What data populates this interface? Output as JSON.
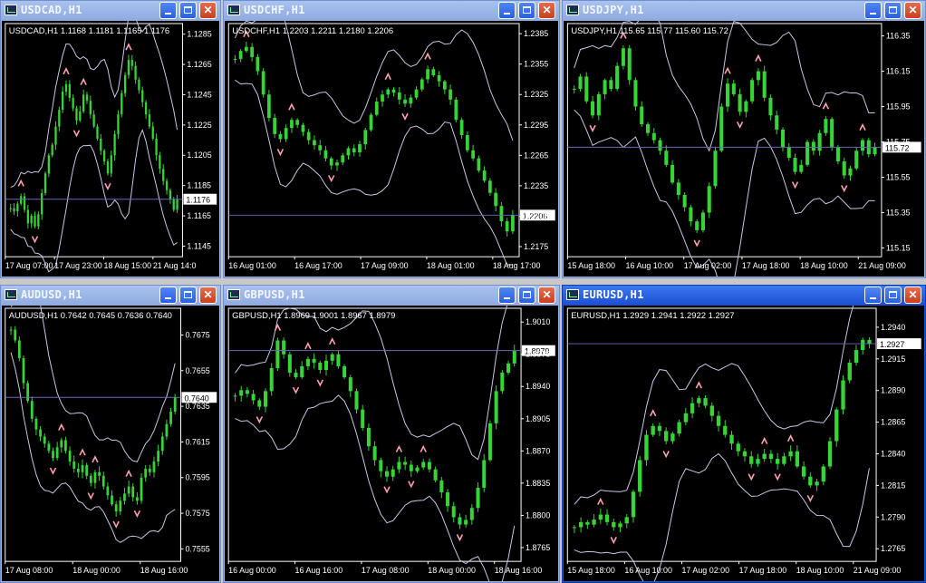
{
  "colors": {
    "bull": "#37d437",
    "band": "#c8c8e6",
    "price_line": "#6a6ab8",
    "arrow": "#ffa0b4",
    "grid": "#ffffff",
    "text": "#ffffff"
  },
  "windows": [
    {
      "id": "usdcad",
      "title": "USDCAD,H1",
      "info": "USDCAD,H1  1.1168 1.1181 1.1165 1.1176",
      "active": false,
      "price_ticks": [
        "1.1285",
        "1.1265",
        "1.1245",
        "1.1225",
        "1.1205",
        "1.1185",
        "1.1165",
        "1.1145"
      ],
      "current_price": "1.1176",
      "time_ticks": [
        "17 Aug 07:00",
        "17 Aug 23:00",
        "18 Aug 15:00",
        "21 Aug 14:0"
      ],
      "chart_data": {
        "type": "candlestick",
        "x_labels": [
          "17 Aug 07:00",
          "17 Aug 23:00",
          "18 Aug 15:00",
          "21 Aug 14:0"
        ],
        "ylim": [
          1.1138,
          1.1292
        ],
        "last": 1.1176,
        "close": [
          1.117,
          1.1168,
          1.1173,
          1.1178,
          1.1169,
          1.116,
          1.1165,
          1.1158,
          1.1166,
          1.118,
          1.1193,
          1.1205,
          1.1212,
          1.1224,
          1.1235,
          1.1247,
          1.1252,
          1.1243,
          1.1236,
          1.1228,
          1.1234,
          1.1245,
          1.1241,
          1.1232,
          1.1224,
          1.1216,
          1.1208,
          1.1201,
          1.1193,
          1.1205,
          1.1219,
          1.1232,
          1.1246,
          1.1258,
          1.1268,
          1.1264,
          1.1255,
          1.1248,
          1.124,
          1.1232,
          1.1224,
          1.1216,
          1.1205,
          1.1196,
          1.1188,
          1.1182,
          1.1176,
          1.1169,
          1.1176
        ]
      }
    },
    {
      "id": "usdchf",
      "title": "USDCHF,H1",
      "info": "USDCHF,H1  1.2203 1.2211 1.2180 1.2206",
      "active": false,
      "price_ticks": [
        "1.2385",
        "1.2355",
        "1.2325",
        "1.2295",
        "1.2265",
        "1.2235",
        "1.2205",
        "1.2175"
      ],
      "current_price": "1.2206",
      "time_ticks": [
        "16 Aug 01:00",
        "16 Aug 17:00",
        "17 Aug 09:00",
        "18 Aug 01:00",
        "18 Aug 17:00"
      ],
      "chart_data": {
        "type": "candlestick",
        "x_labels": [
          "16 Aug 01:00",
          "16 Aug 17:00",
          "17 Aug 09:00",
          "18 Aug 01:00",
          "18 Aug 17:00"
        ],
        "ylim": [
          1.2165,
          1.2395
        ],
        "last": 1.2206,
        "close": [
          1.236,
          1.2368,
          1.2372,
          1.2362,
          1.2348,
          1.2325,
          1.2302,
          1.2286,
          1.2281,
          1.2292,
          1.23,
          1.2295,
          1.2288,
          1.228,
          1.2275,
          1.227,
          1.2262,
          1.2255,
          1.2258,
          1.2265,
          1.2272,
          1.2268,
          1.2276,
          1.229,
          1.2305,
          1.2318,
          1.2325,
          1.233,
          1.2327,
          1.232,
          1.2316,
          1.2322,
          1.233,
          1.234,
          1.235,
          1.2344,
          1.2338,
          1.233,
          1.232,
          1.23,
          1.2285,
          1.227,
          1.2262,
          1.225,
          1.224,
          1.2228,
          1.2215,
          1.22,
          1.219,
          1.2206
        ]
      }
    },
    {
      "id": "usdjpy",
      "title": "USDJPY,H1",
      "info": "USDJPY,H1  115.65 115.77 115.60 115.72",
      "active": false,
      "price_ticks": [
        "116.35",
        "116.15",
        "115.95",
        "115.75",
        "115.55",
        "115.35",
        "115.15"
      ],
      "current_price": "115.72",
      "time_ticks": [
        "15 Aug 18:00",
        "16 Aug 10:00",
        "17 Aug 02:00",
        "17 Aug 18:00",
        "18 Aug 10:00",
        "21 Aug 09:00"
      ],
      "chart_data": {
        "type": "candlestick",
        "x_labels": [
          "15 Aug 18:00",
          "16 Aug 10:00",
          "17 Aug 02:00",
          "17 Aug 18:00",
          "18 Aug 10:00",
          "21 Aug 09:00"
        ],
        "ylim": [
          115.1,
          116.42
        ],
        "last": 115.72,
        "close": [
          116.05,
          116.12,
          115.98,
          115.9,
          116.02,
          116.1,
          116.05,
          116.18,
          116.28,
          116.1,
          115.95,
          115.85,
          115.8,
          115.76,
          115.7,
          115.62,
          115.52,
          115.45,
          115.38,
          115.3,
          115.25,
          115.35,
          115.5,
          115.7,
          115.95,
          116.08,
          116.02,
          115.92,
          115.98,
          116.1,
          116.15,
          116.0,
          115.9,
          115.82,
          115.72,
          115.66,
          115.58,
          115.62,
          115.75,
          115.7,
          115.8,
          115.88,
          115.72,
          115.64,
          115.56,
          115.6,
          115.7,
          115.76,
          115.68,
          115.72
        ]
      }
    },
    {
      "id": "audusd",
      "title": "AUDUSD,H1",
      "info": "AUDUSD,H1  0.7642 0.7645 0.7636 0.7640",
      "active": false,
      "price_ticks": [
        "0.7675",
        "0.7655",
        "0.7635",
        "0.7615",
        "0.7595",
        "0.7575",
        "0.7555"
      ],
      "current_price": "0.7640",
      "time_ticks": [
        "17 Aug 08:00",
        "18 Aug 00:00",
        "18 Aug 16:00"
      ],
      "chart_data": {
        "type": "candlestick",
        "x_labels": [
          "17 Aug 08:00",
          "18 Aug 00:00",
          "18 Aug 16:00"
        ],
        "ylim": [
          0.7548,
          0.769
        ],
        "last": 0.764,
        "close": [
          0.7678,
          0.7672,
          0.7662,
          0.7648,
          0.7638,
          0.7628,
          0.7622,
          0.7618,
          0.7614,
          0.761,
          0.7606,
          0.7612,
          0.7616,
          0.761,
          0.7604,
          0.76,
          0.7598,
          0.7602,
          0.7596,
          0.7592,
          0.7598,
          0.7596,
          0.759,
          0.7585,
          0.758,
          0.7576,
          0.7582,
          0.7586,
          0.759,
          0.7584,
          0.7582,
          0.7595,
          0.76,
          0.7598,
          0.7604,
          0.761,
          0.7618,
          0.7625,
          0.7632,
          0.764
        ]
      }
    },
    {
      "id": "gbpusd",
      "title": "GBPUSD,H1",
      "info": "GBPUSD,H1  1.8969 1.9001 1.8967 1.8979",
      "active": false,
      "price_ticks": [
        "1.9010",
        "1.8975",
        "1.8940",
        "1.8905",
        "1.8870",
        "1.8835",
        "1.8800",
        "1.8765"
      ],
      "current_price": "1.8979",
      "time_ticks": [
        "16 Aug 00:00",
        "16 Aug 16:00",
        "17 Aug 08:00",
        "18 Aug 00:00",
        "18 Aug 16:00"
      ],
      "chart_data": {
        "type": "candlestick",
        "x_labels": [
          "16 Aug 00:00",
          "16 Aug 16:00",
          "17 Aug 08:00",
          "18 Aug 00:00",
          "18 Aug 16:00"
        ],
        "ylim": [
          1.875,
          1.9025
        ],
        "last": 1.8979,
        "close": [
          1.893,
          1.8936,
          1.8932,
          1.8925,
          1.8918,
          1.8935,
          1.896,
          1.899,
          1.8975,
          1.8955,
          1.895,
          1.8962,
          1.897,
          1.8966,
          1.8958,
          1.8968,
          1.8975,
          1.8962,
          1.895,
          1.8935,
          1.8915,
          1.8895,
          1.8875,
          1.886,
          1.8848,
          1.8842,
          1.885,
          1.8858,
          1.8855,
          1.8848,
          1.8852,
          1.8858,
          1.885,
          1.8838,
          1.8825,
          1.881,
          1.8798,
          1.879,
          1.8795,
          1.8808,
          1.883,
          1.886,
          1.89,
          1.8935,
          1.8955,
          1.8965,
          1.8979
        ]
      }
    },
    {
      "id": "eurusd",
      "title": "EURUSD,H1",
      "info": "EURUSD,H1  1.2929 1.2941 1.2922 1.2927",
      "active": true,
      "price_ticks": [
        "1.2940",
        "1.2915",
        "1.2890",
        "1.2865",
        "1.2840",
        "1.2815",
        "1.2790",
        "1.2765"
      ],
      "current_price": "1.2927",
      "time_ticks": [
        "15 Aug 18:00",
        "16 Aug 10:00",
        "17 Aug 02:00",
        "17 Aug 18:00",
        "18 Aug 10:00",
        "21 Aug 09:00"
      ],
      "chart_data": {
        "type": "candlestick",
        "x_labels": [
          "15 Aug 18:00",
          "16 Aug 10:00",
          "17 Aug 02:00",
          "17 Aug 18:00",
          "18 Aug 10:00",
          "21 Aug 09:00"
        ],
        "ylim": [
          1.2755,
          1.2955
        ],
        "last": 1.2927,
        "close": [
          1.2782,
          1.2786,
          1.2784,
          1.2788,
          1.2792,
          1.2786,
          1.2782,
          1.2785,
          1.279,
          1.281,
          1.2835,
          1.2855,
          1.2862,
          1.2858,
          1.285,
          1.2856,
          1.2865,
          1.2872,
          1.288,
          1.2884,
          1.2878,
          1.287,
          1.2862,
          1.2855,
          1.2848,
          1.2842,
          1.2838,
          1.2832,
          1.2836,
          1.284,
          1.2836,
          1.2832,
          1.2838,
          1.2842,
          1.283,
          1.2822,
          1.2815,
          1.2818,
          1.283,
          1.285,
          1.2875,
          1.2898,
          1.2912,
          1.2922,
          1.293,
          1.2927
        ]
      }
    }
  ]
}
